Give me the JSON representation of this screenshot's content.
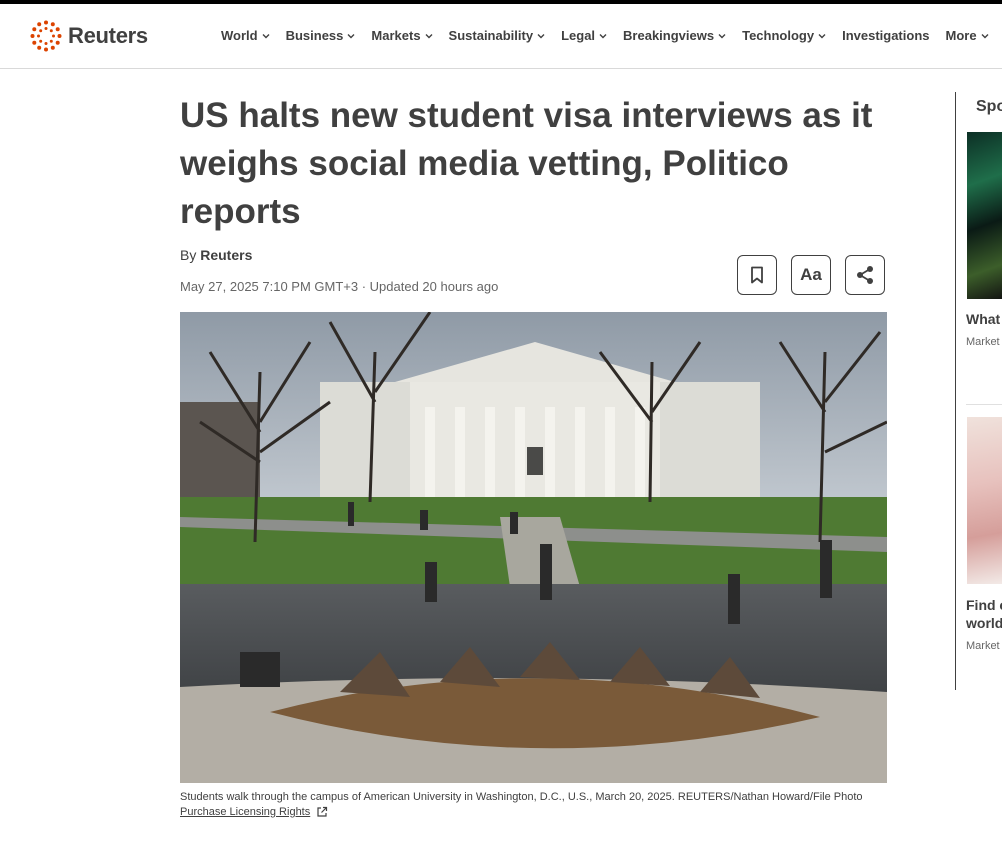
{
  "brand": {
    "name": "Reuters",
    "accent": "#dc4300"
  },
  "nav": {
    "items": [
      {
        "label": "World",
        "has_menu": true
      },
      {
        "label": "Business",
        "has_menu": true
      },
      {
        "label": "Markets",
        "has_menu": true
      },
      {
        "label": "Sustainability",
        "has_menu": true
      },
      {
        "label": "Legal",
        "has_menu": true
      },
      {
        "label": "Breakingviews",
        "has_menu": true
      },
      {
        "label": "Technology",
        "has_menu": true
      },
      {
        "label": "Investigations",
        "has_menu": false
      },
      {
        "label": "More",
        "has_menu": true
      }
    ]
  },
  "article": {
    "headline": "US halts new student visa interviews as it weighs social media vetting, Politico reports",
    "byline_prefix": "By",
    "author": "Reuters",
    "dateline": "May 27, 2025 7:10 PM GMT+3 · Updated 20 hours ago",
    "tools": {
      "bookmark_icon": "bookmark-icon",
      "text_size_label": "Aa",
      "share_icon": "share-icon"
    },
    "photo": {
      "caption": "Students walk through the campus of American University in Washington, D.C., U.S., March 20, 2025. REUTERS/Nathan Howard/File Photo",
      "license_label": "Purchase Licensing Rights"
    }
  },
  "sidebar": {
    "title": "Spo",
    "items": [
      {
        "title": "What",
        "source": "Market"
      },
      {
        "title_line1": "Find c",
        "title_line2": "world",
        "source": "Market"
      }
    ]
  }
}
